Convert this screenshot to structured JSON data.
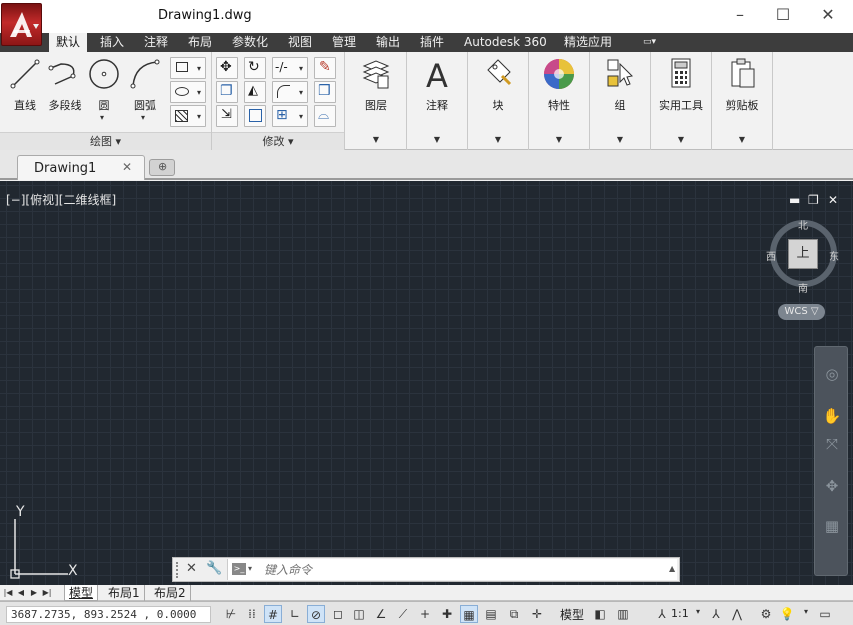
{
  "window": {
    "title": "Drawing1.dwg",
    "minimize_icon": "minimize-icon",
    "maximize_icon": "maximize-icon",
    "close_icon": "close-icon"
  },
  "ribbon": {
    "tabs": [
      {
        "label": "默认",
        "active": true
      },
      {
        "label": "插入"
      },
      {
        "label": "注释"
      },
      {
        "label": "布局"
      },
      {
        "label": "参数化"
      },
      {
        "label": "视图"
      },
      {
        "label": "管理"
      },
      {
        "label": "输出"
      },
      {
        "label": "插件"
      },
      {
        "label": "Autodesk 360"
      },
      {
        "label": "精选应用"
      }
    ],
    "draw_tools": [
      {
        "label": "直线",
        "icon": "line-icon"
      },
      {
        "label": "多段线",
        "icon": "polyline-icon"
      },
      {
        "label": "圆",
        "icon": "circle-icon"
      },
      {
        "label": "圆弧",
        "icon": "arc-icon"
      }
    ],
    "panels": [
      {
        "label": "图层",
        "icon": "layers-icon"
      },
      {
        "label": "注释",
        "icon": "annotation-icon"
      },
      {
        "label": "块",
        "icon": "block-icon"
      },
      {
        "label": "特性",
        "icon": "properties-icon"
      },
      {
        "label": "组",
        "icon": "group-icon"
      },
      {
        "label": "实用工具",
        "icon": "utilities-icon"
      },
      {
        "label": "剪贴板",
        "icon": "clipboard-icon"
      }
    ],
    "draw_panel_label": "绘图",
    "modify_panel_label": "修改"
  },
  "document": {
    "tab_label": "Drawing1"
  },
  "viewport": {
    "label": "[−][俯视][二维线框]",
    "compass": {
      "north": "北",
      "south": "南",
      "east": "东",
      "west": "西"
    },
    "cube_face": "上",
    "wcs": "WCS ▽",
    "ucs_x": "X",
    "ucs_y": "Y"
  },
  "command_line": {
    "placeholder": "键入命令"
  },
  "layout_tabs": [
    "模型",
    "布局1",
    "布局2"
  ],
  "status": {
    "coordinates": "3687.2735, 893.2524 , 0.0000",
    "model_label": "模型",
    "scale": "1:1"
  },
  "colors": {
    "canvas_bg": "#212830",
    "grid": "#2b333d",
    "tab_bar": "#3d3d3d",
    "app_button": "#c22a2a"
  }
}
